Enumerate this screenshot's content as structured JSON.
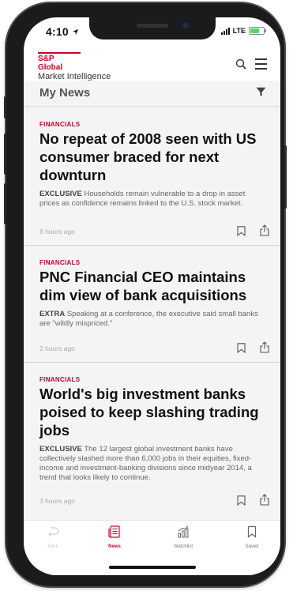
{
  "status_bar": {
    "time": "4:10",
    "carrier": "LTE"
  },
  "header": {
    "logo_line1": "S&P Global",
    "logo_line2": "Market Intelligence"
  },
  "section": {
    "title": "My News"
  },
  "articles": [
    {
      "category": "FINANCIALS",
      "headline": "No repeat of 2008 seen with US consumer braced for next downturn",
      "tag": "EXCLUSIVE",
      "summary": "Households remain vulnerable to a drop in asset prices as confidence remains linked to the U.S. stock market.",
      "time": "8 hours ago"
    },
    {
      "category": "FINANCIALS",
      "headline": "PNC Financial CEO maintains dim view of bank acquisitions",
      "tag": "EXTRA",
      "summary": "Speaking at a conference, the executive said small banks are \"wildly mispriced.\"",
      "time": "2 hours ago"
    },
    {
      "category": "FINANCIALS",
      "headline": "World's big investment banks poised to keep slashing trading jobs",
      "tag": "EXCLUSIVE",
      "summary": "The 12 largest global investment banks have collectively slashed more than 6,000 jobs in their equities, fixed-income and investment-banking divisions since midyear 2014, a trend that looks likely to continue.",
      "time": "3 hours ago"
    }
  ],
  "tab_bar": {
    "tabs": [
      {
        "label": "Back",
        "icon": "back-icon"
      },
      {
        "label": "News",
        "icon": "news-icon"
      },
      {
        "label": "Watchlist",
        "icon": "watchlist-icon"
      },
      {
        "label": "Saved",
        "icon": "saved-icon"
      }
    ]
  },
  "colors": {
    "accent": "#d6002a",
    "background": "#f4f4f5"
  }
}
